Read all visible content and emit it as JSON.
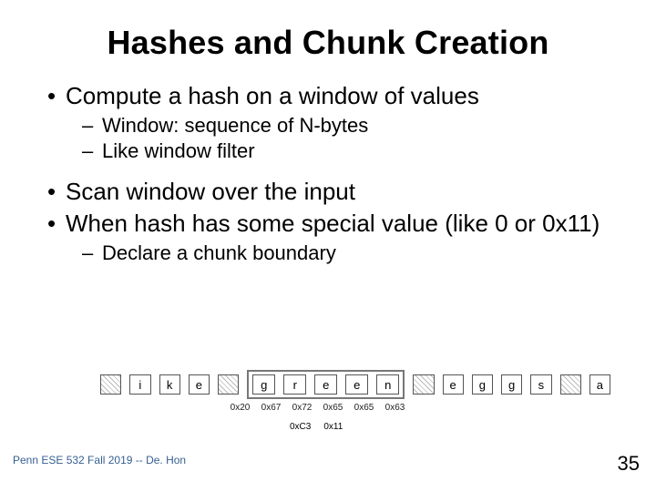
{
  "title": "Hashes and Chunk Creation",
  "bullets": {
    "b1": "Compute a hash on a window of values",
    "b1a": "Window: sequence of N-bytes",
    "b1b": "Like window filter",
    "b2": "Scan window over the input",
    "b3": "When hash has some special value (like 0 or 0x11)",
    "b3a": "Declare a chunk boundary"
  },
  "diagram": {
    "pre": [
      "",
      "i",
      "k",
      "e",
      ""
    ],
    "win": [
      "g",
      "r",
      "e",
      "e",
      "n"
    ],
    "post": [
      "",
      "e",
      "g",
      "g",
      "s",
      "",
      "a"
    ],
    "hex": [
      "0x20",
      "0x67",
      "0x72",
      "0x65",
      "0x65",
      "0x63"
    ],
    "hex2a": "0xC3",
    "hex2b": "0x11"
  },
  "footer": {
    "left": "Penn ESE 532 Fall 2019 -- De. Hon",
    "page": "35"
  }
}
